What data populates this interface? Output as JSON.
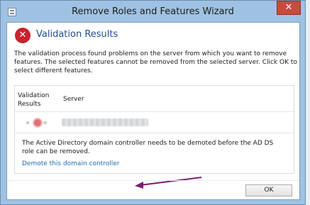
{
  "window": {
    "title": "Remove Roles and Features Wizard",
    "close_glyph": "✕"
  },
  "heading": {
    "text": "Validation Results",
    "icon": "error-icon",
    "icon_glyph": "✕"
  },
  "description": "The validation process found problems on the server from which you want to remove features. The selected features cannot be removed from the selected server.  Click OK to select different features.",
  "table": {
    "headers": {
      "validation_results": "Validation Results",
      "server": "Server"
    },
    "row": {
      "status_icon": "blurred-error-icon",
      "server": ""
    },
    "detail": {
      "message": "The Active Directory domain controller needs to be demoted before the AD DS role can be removed.",
      "link": "Demote this domain controller"
    }
  },
  "buttons": {
    "ok": "OK"
  },
  "colors": {
    "heading": "#1e4e8c",
    "link": "#1e6fb6",
    "error": "#c9232e",
    "close": "#c74b3e",
    "arrow": "#7a1f6e",
    "frame": "#9fc2e2"
  }
}
